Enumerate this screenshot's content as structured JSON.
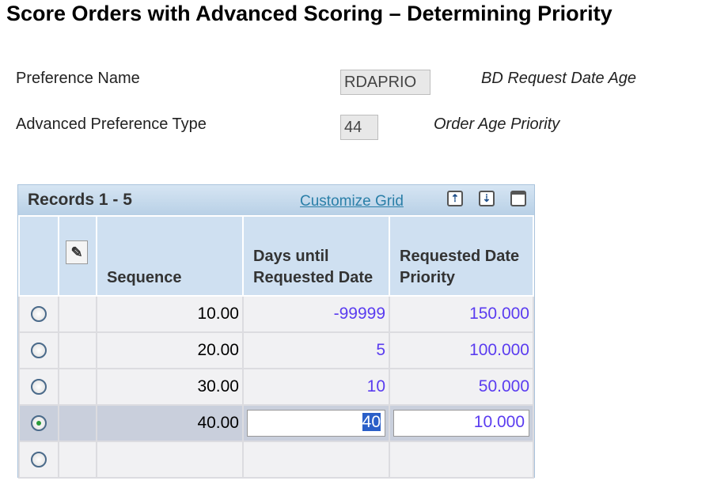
{
  "title": "Score Orders with Advanced Scoring – Determining Priority",
  "fields": {
    "preference_name_label": "Preference Name",
    "preference_name_value": "RDAPRIO",
    "preference_name_desc": "BD Request Date Age",
    "adv_type_label": "Advanced Preference Type",
    "adv_type_value": "44",
    "adv_type_desc": "Order Age Priority"
  },
  "grid": {
    "title": "Records 1 - 5",
    "customize": "Customize Grid",
    "headers": [
      "Sequence",
      "Days until Requested Date",
      "Requested Date Priority"
    ],
    "rows": [
      {
        "seq": "10.00",
        "days": "-99999",
        "priority": "150.000"
      },
      {
        "seq": "20.00",
        "days": "5",
        "priority": "100.000"
      },
      {
        "seq": "30.00",
        "days": "10",
        "priority": "50.000"
      },
      {
        "seq": "40.00",
        "days": "40",
        "priority": "10.000"
      },
      {
        "seq": "",
        "days": "",
        "priority": ""
      }
    ]
  }
}
